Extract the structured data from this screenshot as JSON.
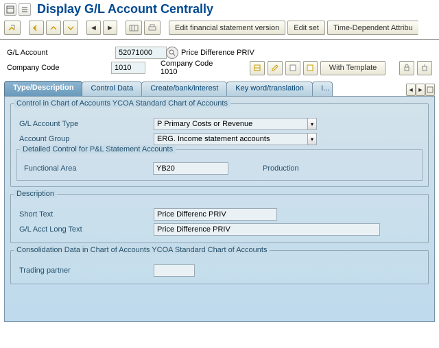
{
  "header": {
    "title": "Display G/L Account Centrally"
  },
  "toolbar": {
    "edit_fsv": "Edit financial statement version",
    "edit_set": "Edit set",
    "time_dep": "Time-Dependent Attribu"
  },
  "fields": {
    "gl_label": "G/L Account",
    "gl_value": "52071000",
    "gl_desc": "Price Difference PRIV",
    "cc_label": "Company Code",
    "cc_value": "1010",
    "cc_desc": "Company Code 1010",
    "with_template": "With Template"
  },
  "tabs": {
    "t1": "Type/Description",
    "t2": "Control Data",
    "t3": "Create/bank/interest",
    "t4": "Key word/translation",
    "t5": "I..."
  },
  "grp1": {
    "title": "Control in Chart of Accounts YCOA Standard Chart of Accounts",
    "acct_type_label": "G/L Account Type",
    "acct_type_value": "P Primary Costs or Revenue",
    "acct_group_label": "Account Group",
    "acct_group_value": "ERG. Income statement accounts",
    "sub_title": "Detailed Control for P&L Statement Accounts",
    "func_area_label": "Functional Area",
    "func_area_value": "YB20",
    "func_area_desc": "Production"
  },
  "grp2": {
    "title": "Description",
    "short_label": "Short Text",
    "short_value": "Price Differenc PRIV",
    "long_label": "G/L Acct Long Text",
    "long_value": "Price Difference PRIV"
  },
  "grp3": {
    "title": "Consolidation Data in Chart of Accounts YCOA Standard Chart of Accounts",
    "tp_label": "Trading partner",
    "tp_value": ""
  }
}
